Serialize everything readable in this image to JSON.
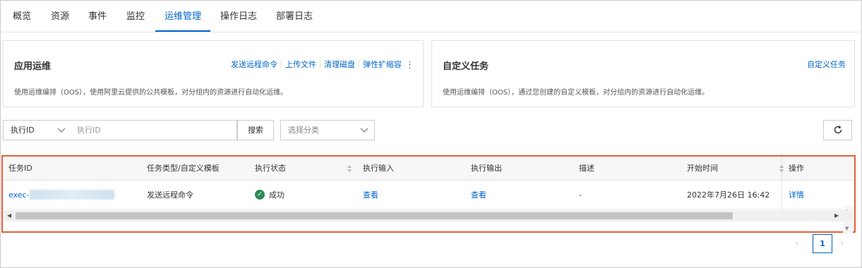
{
  "tabs": [
    {
      "label": "概览"
    },
    {
      "label": "资源"
    },
    {
      "label": "事件"
    },
    {
      "label": "监控"
    },
    {
      "label": "运维管理"
    },
    {
      "label": "操作日志"
    },
    {
      "label": "部署日志"
    }
  ],
  "active_tab": "运维管理",
  "app_ops_card": {
    "title": "应用运维",
    "desc": "使用运维编排（OOS），使用阿里云提供的公共模板，对分组内的资源进行自动化运维。",
    "actions": [
      "发送远程命令",
      "上传文件",
      "清理磁盘",
      "弹性扩缩容"
    ]
  },
  "custom_task_card": {
    "title": "自定义任务",
    "desc": "使用运维编排（OOS），通过您创建的自定义模板，对分组内的资源进行自动化运维。",
    "action": "自定义任务"
  },
  "toolbar": {
    "field_select": "执行ID",
    "search_placeholder": "执行ID",
    "search_button": "搜索",
    "category_select": "选择分类"
  },
  "table": {
    "columns": [
      "任务ID",
      "任务类型/自定义模板",
      "执行状态",
      "执行输入",
      "执行输出",
      "描述",
      "开始时间",
      "操作"
    ],
    "rows": [
      {
        "task_id": "exec-",
        "type": "发送远程命令",
        "status": "成功",
        "input": "查看",
        "output": "查看",
        "desc": "-",
        "start_time": "2022年7月26日 16:42",
        "action": "详情"
      }
    ]
  },
  "pagination": {
    "current_page": "1"
  },
  "colors": {
    "accent": "#0064c8",
    "highlight_border": "#e0623d",
    "success": "#2e8b57"
  }
}
